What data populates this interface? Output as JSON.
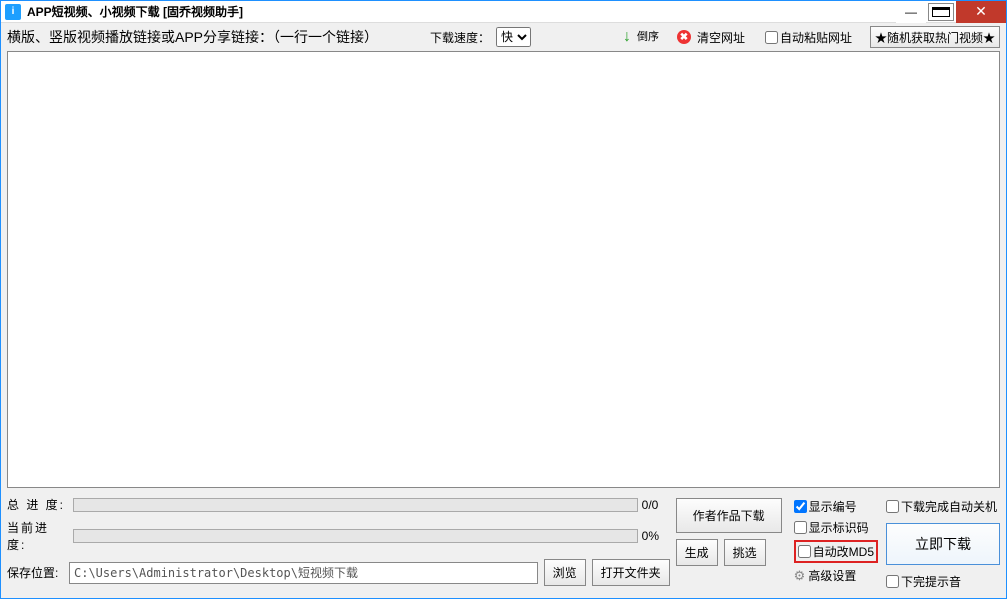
{
  "window": {
    "title": "APP短视频、小视频下载 [固乔视频助手]"
  },
  "toolbar": {
    "main_label": "横版、竖版视频播放链接或APP分享链接：（一行一个链接）",
    "dl_speed_label": "下载速度：",
    "dl_speed_value": "快",
    "reverse": "倒序",
    "clear_label": "清空网址",
    "auto_paste": "自动粘贴网址",
    "hot_btn": "★随机获取热门视频★"
  },
  "progress": {
    "total_label": "总 进 度:",
    "total_text": "0/0",
    "current_label": "当前进度:",
    "current_text": "0%"
  },
  "save": {
    "label": "保存位置:",
    "path": "C:\\Users\\Administrator\\Desktop\\短视频下载",
    "browse": "浏览",
    "open_folder": "打开文件夹",
    "gen": "生成",
    "pick": "挑选"
  },
  "buttons": {
    "author_works": "作者作品下载",
    "download_now": "立即下载"
  },
  "checks": {
    "show_index": "显示编号",
    "show_id": "显示标识码",
    "auto_md5": "自动改MD5",
    "advanced": "高级设置",
    "auto_shutdown": "下载完成自动关机",
    "done_sound": "下完提示音"
  }
}
